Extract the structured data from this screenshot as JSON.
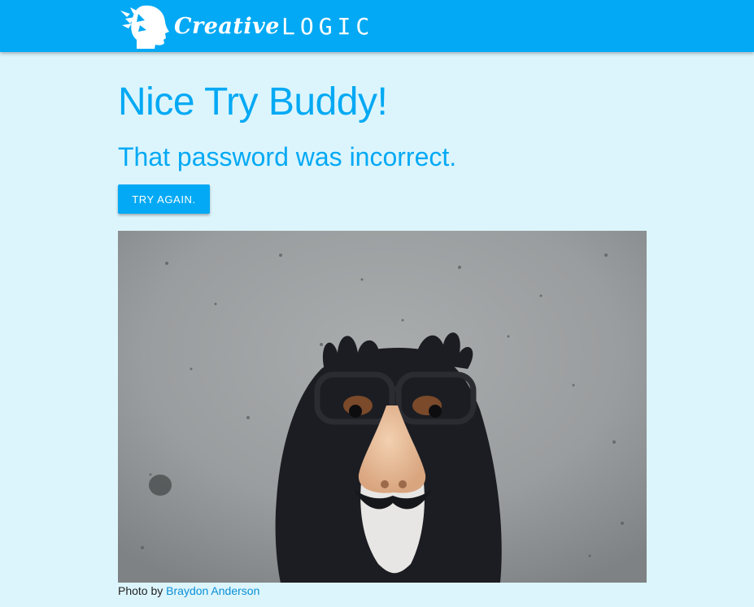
{
  "brand": {
    "name_part1": "Creative",
    "name_part2": "LOGIC",
    "logo_icon": "head-with-birds-icon"
  },
  "main": {
    "heading": "Nice Try Buddy!",
    "subheading": "That password was incorrect.",
    "retry_button_label": "TRY AGAIN.",
    "photo_alt": "Dog wearing novelty glasses and fake nose",
    "caption_prefix": "Photo by",
    "caption_credit": "Braydon Anderson"
  },
  "colors": {
    "accent": "#03a9f4",
    "page_background": "#dcf5fd",
    "link": "#0a8fd6"
  }
}
